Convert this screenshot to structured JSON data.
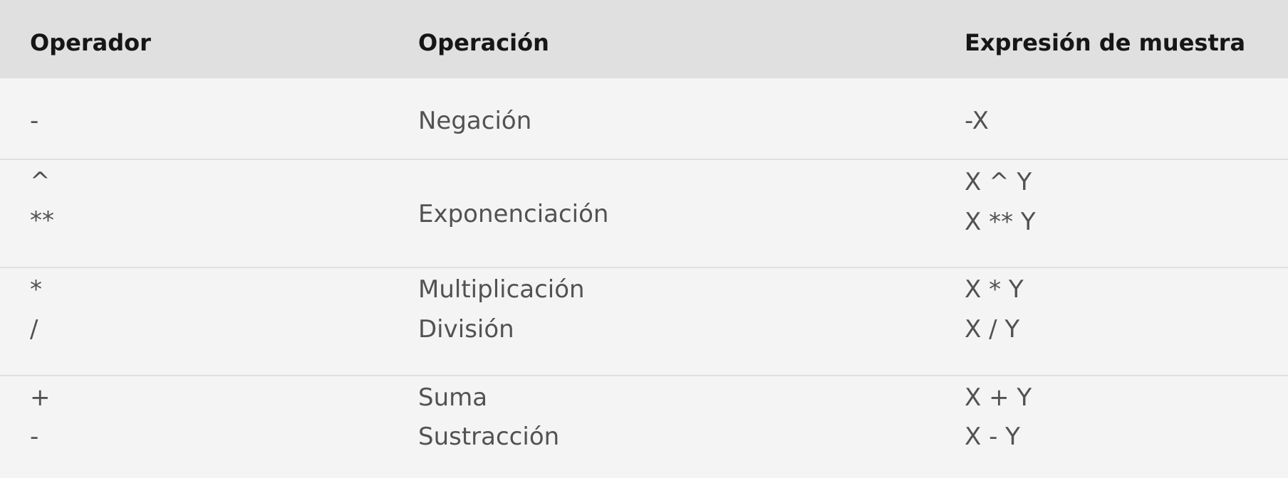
{
  "table": {
    "headers": [
      "Operador",
      "Operación",
      "Expresión de muestra"
    ],
    "rows": [
      {
        "operators": [
          "-"
        ],
        "operations": [
          "Negación"
        ],
        "expressions": [
          "-X"
        ]
      },
      {
        "operators": [
          "^",
          "**"
        ],
        "operations": [
          "Exponenciación"
        ],
        "expressions": [
          "X ^ Y",
          "X ** Y"
        ]
      },
      {
        "operators": [
          "*",
          "/"
        ],
        "operations": [
          "Multiplicación",
          "División"
        ],
        "expressions": [
          "X * Y",
          "X / Y"
        ]
      },
      {
        "operators": [
          "+",
          "-"
        ],
        "operations": [
          "Suma",
          "Sustracción"
        ],
        "expressions": [
          "X + Y",
          "X - Y"
        ]
      }
    ]
  }
}
